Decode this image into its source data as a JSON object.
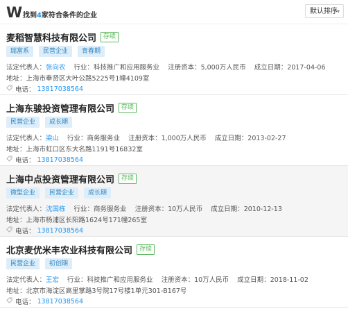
{
  "header": {
    "logo": "W",
    "result_prefix": "找到",
    "result_count": "4",
    "result_suffix": "家符合条件的企业",
    "sort_label": "默认排序",
    "sort_chevron": "▾"
  },
  "labels": {
    "rep": "法定代表人：",
    "industry": "行业：",
    "capital": "注册资本：",
    "date": "成立日期：",
    "address": "地址：",
    "phone": "电话："
  },
  "companies": [
    {
      "name": "麦稻智慧科技有限公司",
      "status": "存续",
      "tags": [
        "瑞富系",
        "民营企业",
        "青春期"
      ],
      "rep": "张向农",
      "industry": "科技推广和应用服务业",
      "capital": "5,000万人民币",
      "date": "2017-04-06",
      "address": "上海市奉贤区大叶公路5225号1幢4109室",
      "phone": "13817038564"
    },
    {
      "name": "上海东骏投资管理有限公司",
      "status": "存续",
      "tags": [
        "民营企业",
        "成长期"
      ],
      "rep": "梁山",
      "industry": "商务服务业",
      "capital": "1,000万人民币",
      "date": "2013-02-27",
      "address": "上海市虹口区东大名路1191号16832室",
      "phone": "13817038564"
    },
    {
      "name": "上海中点投资管理有限公司",
      "status": "存续",
      "tags": [
        "微型企业",
        "民营企业",
        "成长期"
      ],
      "rep": "沈国栋",
      "industry": "商务服务业",
      "capital": "10万人民币",
      "date": "2010-12-13",
      "address": "上海市杨浦区长阳路1624号171幢265室",
      "phone": "13817038564"
    },
    {
      "name": "北京麦优米丰农业科技有限公司",
      "status": "存续",
      "tags": [
        "民营企业",
        "初创期"
      ],
      "rep": "王宏",
      "industry": "科技推广和应用服务业",
      "capital": "10万人民币",
      "date": "2018-11-02",
      "address": "北京市海淀区高里掌路3号院17号楼1单元301-B167号",
      "phone": "13817038564"
    }
  ]
}
